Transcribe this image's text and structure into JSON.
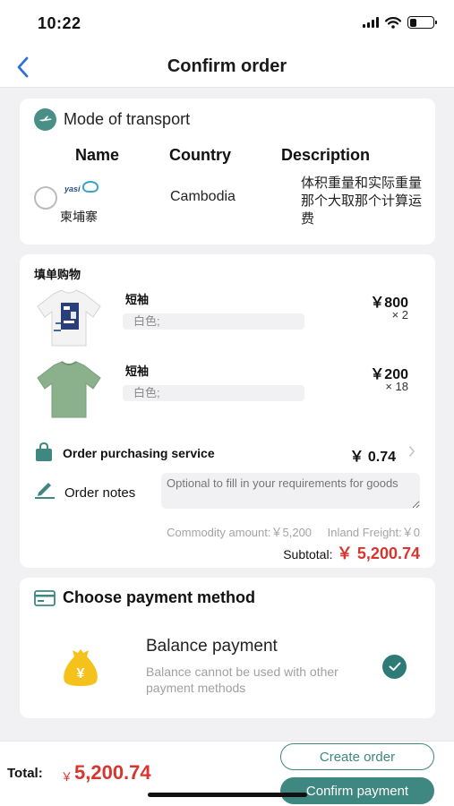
{
  "status": {
    "time": "10:22"
  },
  "nav": {
    "title": "Confirm order",
    "back_icon": "chevron-left-icon"
  },
  "transport": {
    "section_title": "Mode of transport",
    "columns": {
      "name": "Name",
      "country": "Country",
      "description": "Description"
    },
    "route": {
      "logo_text": "yasi",
      "name": "柬埔寨",
      "country": "Cambodia",
      "description": "体积重量和实际重量那个大取那个计算运费",
      "selected": false
    }
  },
  "order": {
    "section_title": "填单购物",
    "products": [
      {
        "name": "短袖",
        "spec": "白色;",
        "price": "￥800",
        "qty": "× 2",
        "image": "tshirt-white"
      },
      {
        "name": "短袖",
        "spec": "白色;",
        "price": "￥200",
        "qty": "× 18",
        "image": "tshirt-green"
      }
    ],
    "service": {
      "label": "Order purchasing service",
      "price": "￥ 0.74"
    },
    "notes": {
      "label": "Order notes",
      "placeholder": "Optional to fill in your requirements for goods"
    },
    "summary": {
      "commodity": "Commodity amount:￥5,200",
      "freight": "Inland Freight:￥0",
      "subtotal_label": "Subtotal:",
      "subtotal_value": "￥ 5,200.74"
    }
  },
  "payment": {
    "section_title": "Choose payment method",
    "method": "Balance payment",
    "note": "Balance cannot be used with other payment methods",
    "selected": true
  },
  "footer": {
    "total_label": "Total:",
    "currency": "￥",
    "total_value": "5,200.74",
    "create_label": "Create order",
    "confirm_label": "Confirm payment"
  },
  "colors": {
    "accent": "#3f8781",
    "price_red": "#d8352e",
    "background": "#f1f1f3"
  }
}
